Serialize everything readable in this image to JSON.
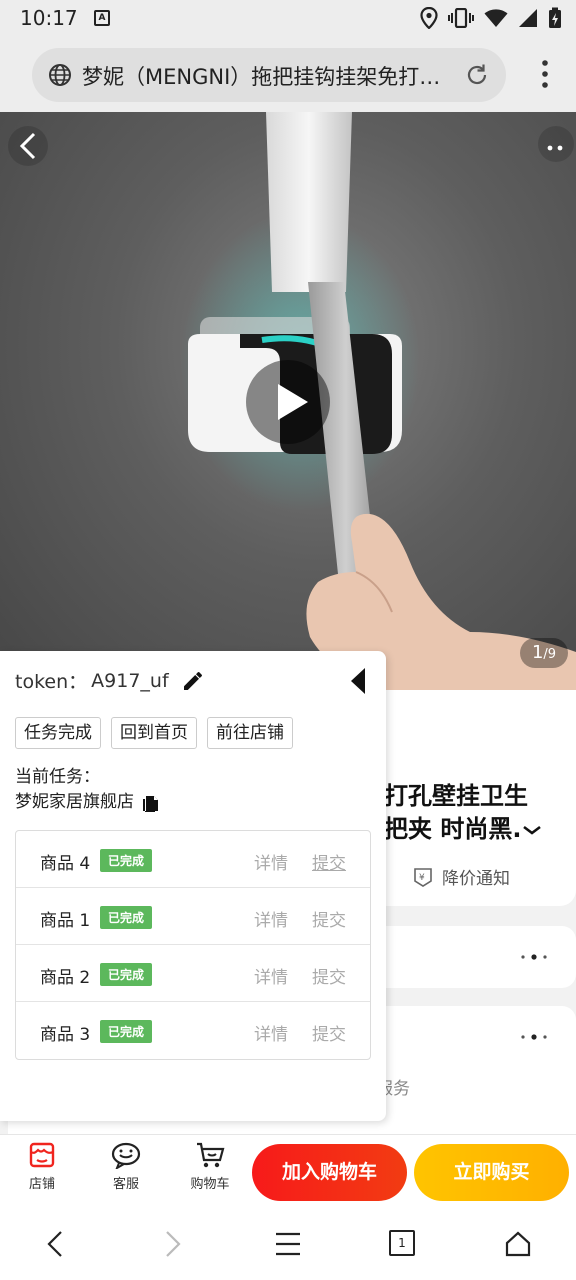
{
  "status": {
    "time": "10:17",
    "notif_letter": "A"
  },
  "browser": {
    "url_title": "梦妮（MENGNI）拖把挂钩挂架免打孔壁挂卫生间拖把夹"
  },
  "hero": {
    "image_counter_current": "1",
    "image_counter_total": "/9"
  },
  "product": {
    "title_line1": "打孔壁挂卫生",
    "title_line2": "把夹 时尚黑.",
    "price_notice": "降价通知",
    "service_partial": "服务"
  },
  "panel": {
    "token_label": "token：",
    "token_value": "A917_uf",
    "buttons": [
      "任务完成",
      "回到首页",
      "前往店铺"
    ],
    "current_task_label": "当前任务：",
    "current_task_shop": "梦妮家居旗舰店",
    "rows": [
      {
        "name": "商品 4",
        "status": "已完成",
        "detail": "详情",
        "submit": "提交"
      },
      {
        "name": "商品 1",
        "status": "已完成",
        "detail": "详情",
        "submit": "提交"
      },
      {
        "name": "商品 2",
        "status": "已完成",
        "detail": "详情",
        "submit": "提交"
      },
      {
        "name": "商品 3",
        "status": "已完成",
        "detail": "详情",
        "submit": "提交"
      }
    ]
  },
  "bottom": {
    "shop": "店铺",
    "service": "客服",
    "cart": "购物车",
    "add_cart": "加入购物车",
    "buy_now": "立即购买"
  },
  "sysnav": {
    "tabs_count": "1"
  },
  "colors": {
    "add_cart": "#f71a1a",
    "buy_now": "#ffc400",
    "done_badge": "#5cb85c",
    "accent_teal": "#2ee6d9"
  }
}
